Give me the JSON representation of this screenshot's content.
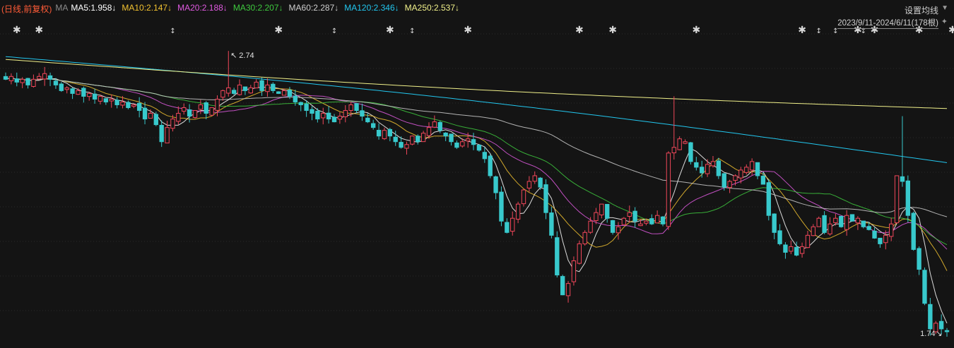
{
  "header": {
    "mode_label": "(日线,前复权)",
    "ma_prefix": "MA",
    "settings_label": "设置均线",
    "settings_caret": "▼",
    "range_label": "2023/9/11-2024/6/11(178根)",
    "pin_icon": "pin-icon"
  },
  "ma_items": [
    {
      "label": "MA5:1.958",
      "arrow": "↓",
      "color": "#ffffff"
    },
    {
      "label": "MA10:2.147",
      "arrow": "↓",
      "color": "#f2c230"
    },
    {
      "label": "MA20:2.188",
      "arrow": "↓",
      "color": "#e05ae0"
    },
    {
      "label": "MA30:2.207",
      "arrow": "↓",
      "color": "#3ec93e"
    },
    {
      "label": "MA60:2.287",
      "arrow": "↓",
      "color": "#cfcfcf"
    },
    {
      "label": "MA120:2.346",
      "arrow": "↓",
      "color": "#22c6ee"
    },
    {
      "label": "MA250:2.537",
      "arrow": "↓",
      "color": "#f0f08a"
    }
  ],
  "colors": {
    "background": "#141414",
    "up": "#f0475a",
    "down": "#38c9cc",
    "grid": "#2a2a2a",
    "mode_label": "#ff5b37"
  },
  "chart_data": {
    "type": "candlestick",
    "candle_count": 178,
    "date_range": [
      "2023/9/11",
      "2024/6/11"
    ],
    "high_label": "2.74",
    "low_label": "1.74",
    "high_value": 2.74,
    "low_value": 1.74,
    "ylim": [
      1.72,
      2.82
    ],
    "grid": true,
    "moving_averages": [
      {
        "name": "MA5",
        "last": 1.958
      },
      {
        "name": "MA10",
        "last": 2.147
      },
      {
        "name": "MA20",
        "last": 2.188
      },
      {
        "name": "MA30",
        "last": 2.207
      },
      {
        "name": "MA60",
        "last": 2.287
      },
      {
        "name": "MA120",
        "last": 2.346
      },
      {
        "name": "MA250",
        "last": 2.537
      }
    ],
    "closes": [
      2.64,
      2.65,
      2.63,
      2.64,
      2.62,
      2.64,
      2.65,
      2.66,
      2.64,
      2.62,
      2.6,
      2.61,
      2.59,
      2.6,
      2.58,
      2.59,
      2.57,
      2.58,
      2.56,
      2.57,
      2.55,
      2.56,
      2.54,
      2.55,
      2.53,
      2.5,
      2.52,
      2.48,
      2.42,
      2.47,
      2.5,
      2.52,
      2.54,
      2.51,
      2.53,
      2.55,
      2.52,
      2.54,
      2.57,
      2.6,
      2.61,
      2.59,
      2.62,
      2.6,
      2.61,
      2.63,
      2.6,
      2.62,
      2.6,
      2.59,
      2.6,
      2.58,
      2.56,
      2.55,
      2.53,
      2.52,
      2.5,
      2.52,
      2.5,
      2.49,
      2.51,
      2.53,
      2.55,
      2.53,
      2.51,
      2.49,
      2.47,
      2.44,
      2.46,
      2.44,
      2.42,
      2.4,
      2.41,
      2.44,
      2.42,
      2.45,
      2.47,
      2.49,
      2.46,
      2.44,
      2.42,
      2.4,
      2.42,
      2.43,
      2.41,
      2.39,
      2.36,
      2.3,
      2.24,
      2.14,
      2.1,
      2.15,
      2.2,
      2.25,
      2.28,
      2.3,
      2.26,
      2.17,
      2.09,
      1.95,
      1.88,
      1.92,
      2.0,
      2.06,
      2.1,
      2.14,
      2.17,
      2.2,
      2.15,
      2.1,
      2.12,
      2.15,
      2.17,
      2.14,
      2.13,
      2.14,
      2.13,
      2.16,
      2.13,
      2.38,
      2.4,
      2.43,
      2.42,
      2.35,
      2.33,
      2.31,
      2.34,
      2.35,
      2.3,
      2.26,
      2.28,
      2.3,
      2.32,
      2.33,
      2.35,
      2.3,
      2.27,
      2.16,
      2.1,
      2.06,
      2.03,
      2.05,
      2.02,
      2.05,
      2.09,
      2.12,
      2.15,
      2.1,
      2.13,
      2.15,
      2.12,
      2.16,
      2.14,
      2.15,
      2.12,
      2.11,
      2.08,
      2.06,
      2.09,
      2.13,
      2.3,
      2.28,
      2.16,
      2.04,
      1.97,
      1.85,
      1.76,
      1.78,
      1.76,
      1.75
    ]
  }
}
